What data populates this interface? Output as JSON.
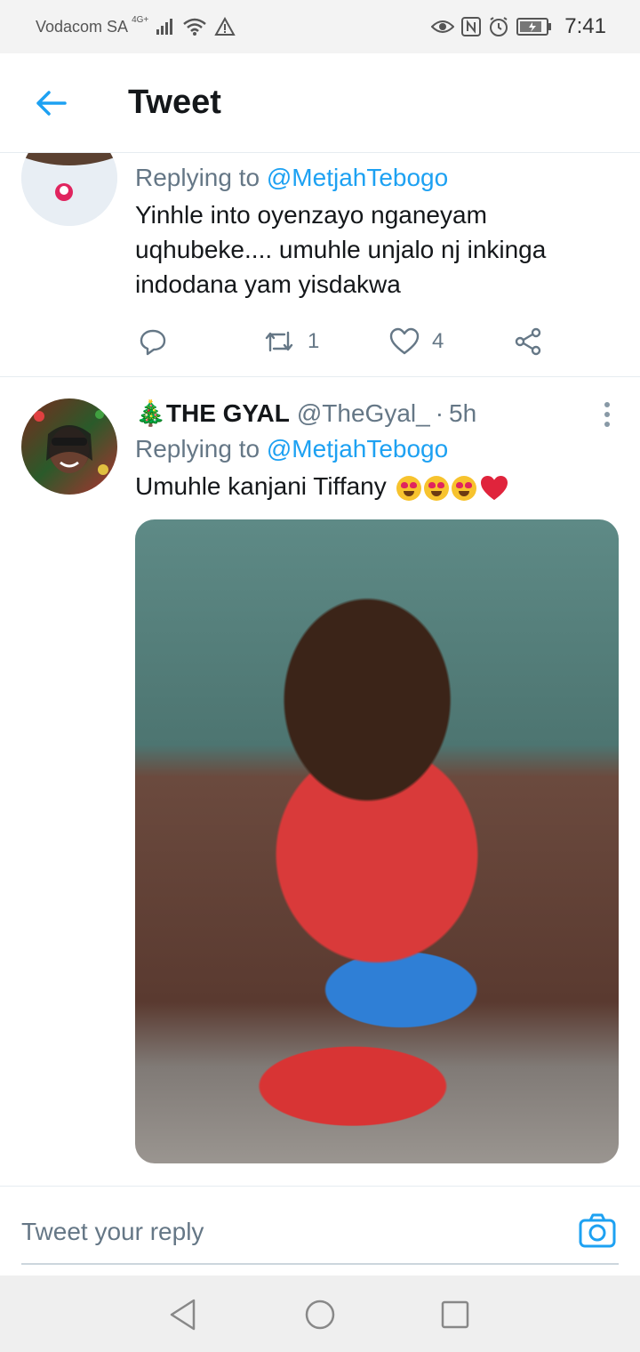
{
  "status_bar": {
    "carrier": "Vodacom SA",
    "network_type": "4G+",
    "time": "7:41",
    "icons": [
      "signal-icon",
      "wifi-icon",
      "alert-icon",
      "eye-icon",
      "nfc-icon",
      "alarm-icon",
      "battery-icon"
    ]
  },
  "header": {
    "title": "Tweet",
    "back_icon": "back-arrow-icon"
  },
  "tweets": [
    {
      "replying_prefix": "Replying to",
      "replying_handle": "@MetjahTebogo",
      "text_line1": "Yinhle into oyenzayo nganeyam",
      "text_line2": "uqhubeke.... umuhle unjalo nj inkinga",
      "text_line3": "indodana yam yisdakwa",
      "actions": {
        "reply_icon": "reply-icon",
        "retweet_icon": "retweet-icon",
        "retweet_count": "1",
        "like_icon": "heart-icon",
        "like_count": "4",
        "share_icon": "share-icon"
      }
    },
    {
      "name_emoji": "🎄",
      "display_name": "THE GYAL",
      "handle": "@TheGyal_",
      "separator": "·",
      "time": "5h",
      "replying_prefix": "Replying to",
      "replying_handle": "@MetjahTebogo",
      "text": "Umuhle kanjani Tiffany",
      "text_emojis": [
        "heart-eyes",
        "heart-eyes",
        "heart-eyes",
        "red-heart"
      ],
      "has_media": true
    }
  ],
  "reply_bar": {
    "placeholder": "Tweet your reply",
    "camera_icon": "camera-icon"
  },
  "nav_bar": {
    "icons": [
      "nav-back-icon",
      "nav-home-icon",
      "nav-recents-icon"
    ]
  },
  "colors": {
    "accent": "#1da1f2",
    "secondary_text": "#657786",
    "primary_text": "#14171a",
    "divider": "#e6ecf0"
  }
}
